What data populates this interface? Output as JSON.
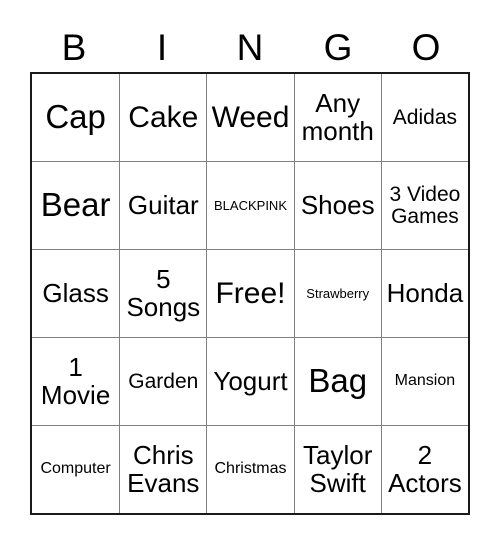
{
  "card": {
    "header_letters": [
      "B",
      "I",
      "N",
      "G",
      "O"
    ],
    "rows": [
      [
        {
          "text": "Cap",
          "size": "xl"
        },
        {
          "text": "Cake",
          "size": "lg"
        },
        {
          "text": "Weed",
          "size": "lg"
        },
        {
          "text": "Any\nmonth",
          "size": "md"
        },
        {
          "text": "Adidas",
          "size": "sm"
        }
      ],
      [
        {
          "text": "Bear",
          "size": "xl"
        },
        {
          "text": "Guitar",
          "size": "md"
        },
        {
          "text": "BLACKPINK",
          "size": "xxs"
        },
        {
          "text": "Shoes",
          "size": "md"
        },
        {
          "text": "3 Video\nGames",
          "size": "sm"
        }
      ],
      [
        {
          "text": "Glass",
          "size": "md"
        },
        {
          "text": "5\nSongs",
          "size": "md"
        },
        {
          "text": "Free!",
          "size": "lg"
        },
        {
          "text": "Strawberry",
          "size": "xxs"
        },
        {
          "text": "Honda",
          "size": "md"
        }
      ],
      [
        {
          "text": "1\nMovie",
          "size": "md"
        },
        {
          "text": "Garden",
          "size": "sm"
        },
        {
          "text": "Yogurt",
          "size": "md"
        },
        {
          "text": "Bag",
          "size": "xl"
        },
        {
          "text": "Mansion",
          "size": "xs"
        }
      ],
      [
        {
          "text": "Computer",
          "size": "xs"
        },
        {
          "text": "Chris\nEvans",
          "size": "md"
        },
        {
          "text": "Christmas",
          "size": "xs"
        },
        {
          "text": "Taylor\nSwift",
          "size": "md"
        },
        {
          "text": "2\nActors",
          "size": "md"
        }
      ]
    ]
  }
}
